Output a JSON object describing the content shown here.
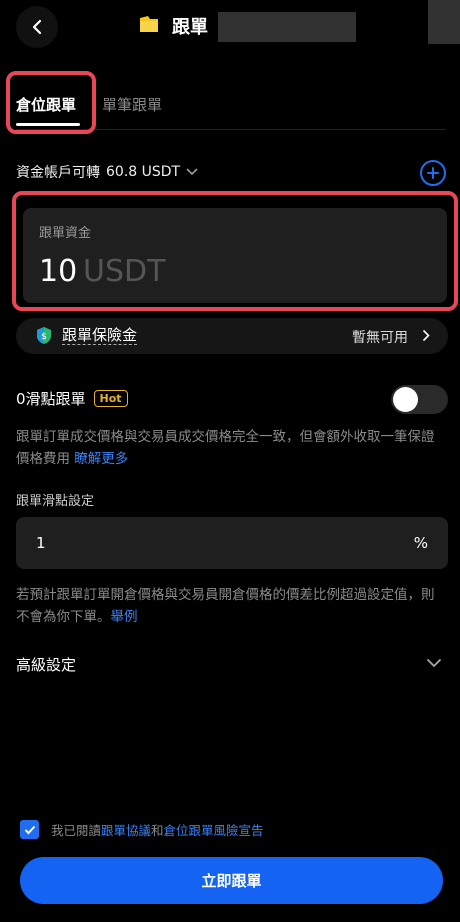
{
  "header": {
    "title": "跟單",
    "back_icon": "chevron-left-icon",
    "logo_color": "#f5c518"
  },
  "tabs": [
    {
      "label": "倉位跟單",
      "active": true
    },
    {
      "label": "單筆跟單",
      "active": false
    }
  ],
  "available": {
    "label": "資金帳戶可轉",
    "value": "60.8 USDT"
  },
  "amount": {
    "label": "跟單資金",
    "value": "10",
    "unit": "USDT"
  },
  "insurance": {
    "label": "跟單保險金",
    "status": "暫無可用"
  },
  "zero_slippage": {
    "title": "0滑點跟單",
    "badge": "Hot",
    "enabled": false,
    "description": "跟單訂單成交價格與交易員成交價格完全一致，但會額外收取一筆保證價格費用",
    "link": "瞭解更多"
  },
  "slippage_setting": {
    "label": "跟單滑點設定",
    "value": "1",
    "unit": "%",
    "description": "若預計跟單訂單開倉價格與交易員開倉價格的價差比例超過設定值，則不會為你下單。",
    "link": "舉例"
  },
  "advanced": {
    "label": "高級設定"
  },
  "agreement": {
    "checked": true,
    "prefix": "我已閱讀",
    "link1": "跟單協議",
    "middle": "和",
    "link2": "倉位跟單風險宣告"
  },
  "submit_label": "立即跟單",
  "colors": {
    "accent": "#1463f3",
    "highlight": "#e84757",
    "hot": "#e6b422"
  }
}
